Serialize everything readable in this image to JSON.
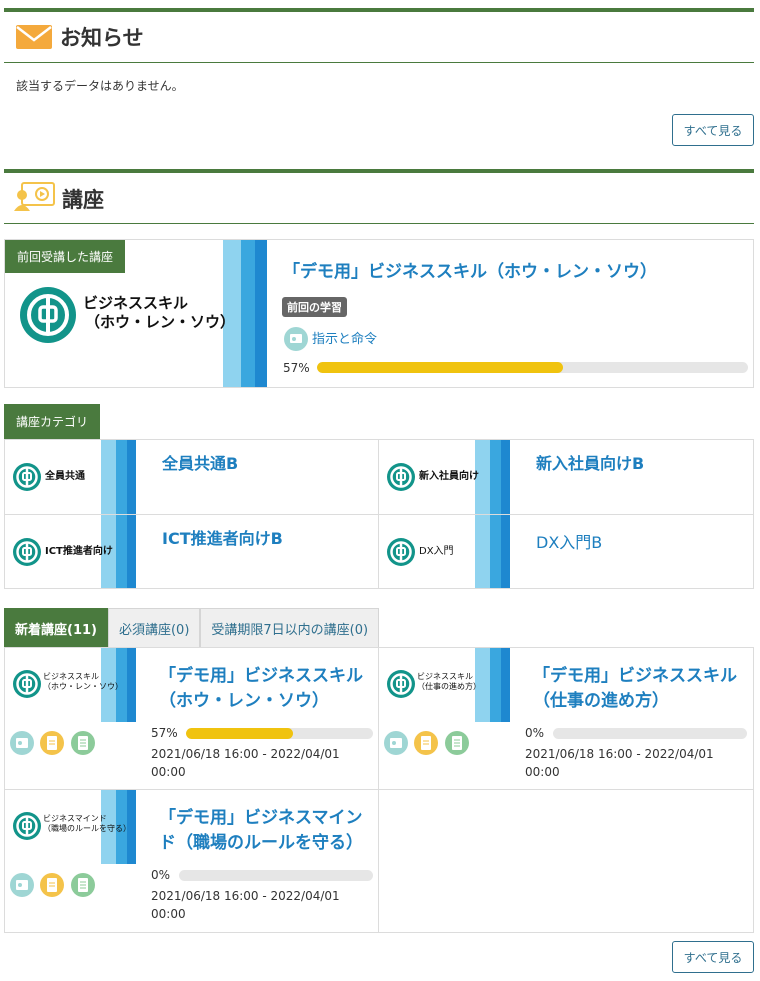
{
  "notice": {
    "title": "お知らせ",
    "empty_message": "該当するデータはありません。",
    "see_all": "すべて見る"
  },
  "courses": {
    "title": "講座",
    "last_course": {
      "tag": "前回受講した講座",
      "thumb_text_line1": "ビジネススキル",
      "thumb_text_line2": "（ホウ・レン・ソウ）",
      "title": "「デモ用」ビジネススキル（ホウ・レン・ソウ）",
      "last_learning_badge": "前回の学習",
      "lesson": "指示と命令",
      "progress_label": "57%",
      "progress": 0.57
    },
    "category": {
      "tag": "講座カテゴリ",
      "items": [
        {
          "thumb_text": "全員共通",
          "title": "全員共通B"
        },
        {
          "thumb_text": "新入社員向け",
          "title": "新入社員向けB"
        },
        {
          "thumb_text": "ICT推進者向け",
          "title": "ICT推進者向けB"
        },
        {
          "thumb_text": "DX入門",
          "title": "DX入門B"
        }
      ]
    },
    "tabs": [
      {
        "label": "新着講座(11)"
      },
      {
        "label": "必須講座(0)"
      },
      {
        "label": "受講期限7日以内の講座(0)"
      }
    ],
    "new_courses": [
      {
        "thumb_line1": "ビジネススキル",
        "thumb_line2": "（ホウ・レン・ソウ）",
        "title_line1": "「デモ用」ビジネススキル",
        "title_line2": "（ホウ・レン・ソウ）",
        "progress_label": "57%",
        "progress": 0.57,
        "date_line1": "2021/06/18 16:00 - 2022/04/01",
        "date_line2": "00:00"
      },
      {
        "thumb_line1": "ビジネススキル",
        "thumb_line2": "（仕事の進め方）",
        "title_line1": "「デモ用」ビジネススキル",
        "title_line2": "（仕事の進め方）",
        "progress_label": "0%",
        "progress": 0,
        "date_line1": "2021/06/18 16:00 - 2022/04/01",
        "date_line2": "00:00"
      },
      {
        "thumb_line1": "ビジネスマインド",
        "thumb_line2": "（職場のルールを守る）",
        "title_line1": "「デモ用」ビジネスマイン",
        "title_line2": "ド（職場のルールを守る）",
        "progress_label": "0%",
        "progress": 0,
        "date_line1": "2021/06/18 16:00 - 2022/04/01",
        "date_line2": "00:00"
      }
    ],
    "see_all": "すべて見る"
  },
  "icons": {
    "notice": "envelope-icon",
    "courses": "video-lesson-icon",
    "lesson": "video-lesson-icon",
    "resource": [
      "video-icon",
      "document-icon",
      "list-icon"
    ]
  },
  "colors": {
    "accent_green": "#4a7a3e",
    "link_blue": "#1e7fbf",
    "progress_yellow": "#f0c30f",
    "logo_teal": "#12948a"
  }
}
